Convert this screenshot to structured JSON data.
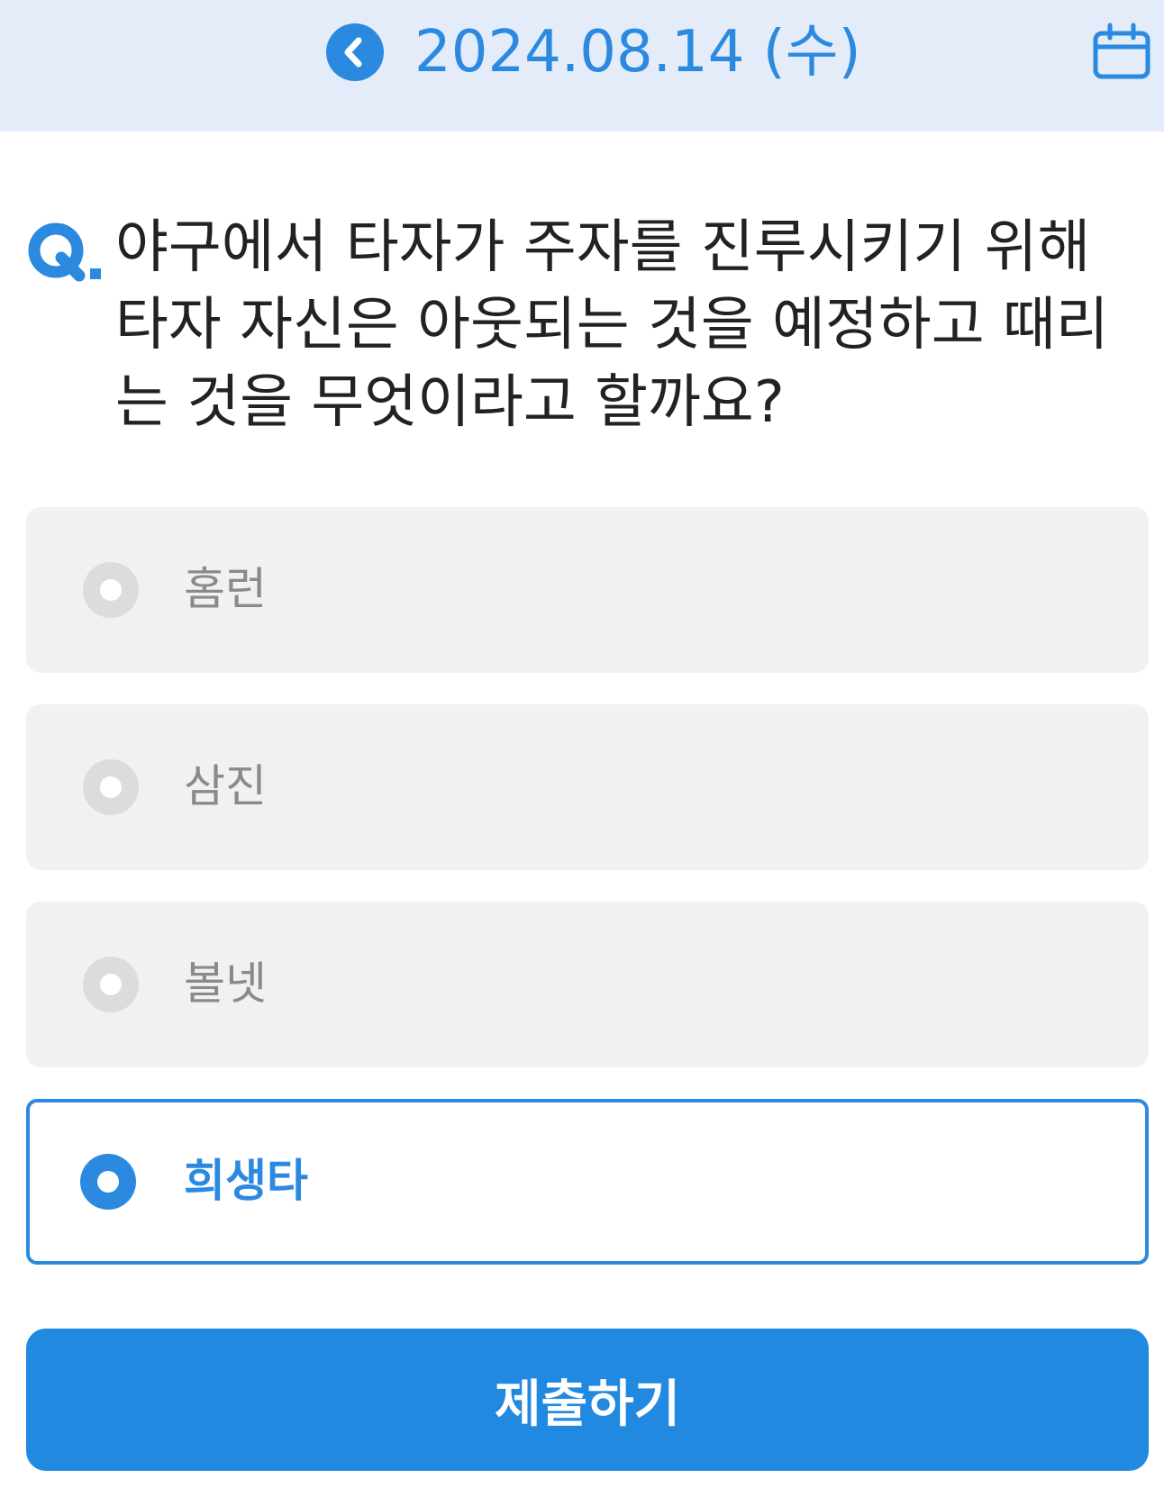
{
  "header": {
    "back_icon": "chevron-left-icon",
    "date": "2024.08.14 (수)",
    "calendar_icon": "calendar-icon"
  },
  "question": {
    "prefix_icon": "q-mark-icon",
    "text": "야구에서 타자가 주자를 진루시키기 위해 타자 자신은 아웃되는 것을 예정하고 때리는 것을 무엇이라고 할까요?"
  },
  "options": [
    {
      "label": "홈런",
      "selected": false
    },
    {
      "label": "삼진",
      "selected": false
    },
    {
      "label": "볼넷",
      "selected": false
    },
    {
      "label": "희생타",
      "selected": true
    }
  ],
  "submit": {
    "label": "제출하기"
  },
  "colors": {
    "accent": "#2b8ae0",
    "header_bg": "#e3ecf8",
    "option_bg": "#f1f1f1",
    "option_text": "#8a8a8a",
    "question_text": "#222222"
  }
}
